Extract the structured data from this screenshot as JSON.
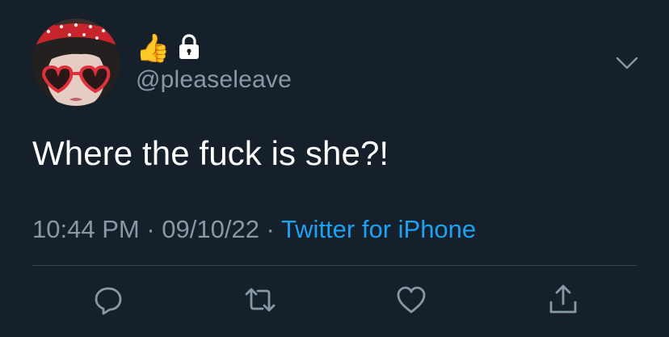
{
  "user": {
    "handle": "@pleaseleave",
    "name_emoji": "👍",
    "badge_icon": "lock-icon"
  },
  "tweet": {
    "text": "Where the fuck is she?!",
    "time": "10:44 PM",
    "separator": " · ",
    "date": "09/10/22",
    "source": "Twitter for iPhone"
  },
  "actions": {
    "reply_icon": "reply-icon",
    "retweet_icon": "retweet-icon",
    "like_icon": "heart-icon",
    "share_icon": "share-icon"
  },
  "colors": {
    "background": "#15202b",
    "text": "#ffffff",
    "secondary": "#8899a6",
    "link": "#1da1f2",
    "divider": "#38444d"
  }
}
